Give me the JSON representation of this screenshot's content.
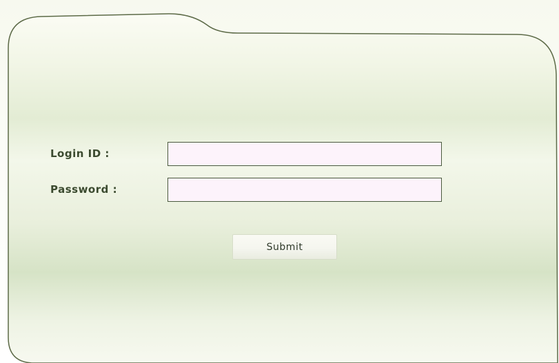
{
  "login_form": {
    "login_id_label": "Login ID :",
    "login_id_value": "",
    "password_label": "Password :",
    "password_value": "",
    "submit_label": "Submit"
  },
  "colors": {
    "panel_border": "#5c6a47",
    "panel_fill_light": "#f3f7ea",
    "panel_fill_mid": "#d6e4c6",
    "input_background": "#fdf3fb",
    "input_border": "#4a5a3e",
    "label_text": "#3b4a2f"
  }
}
